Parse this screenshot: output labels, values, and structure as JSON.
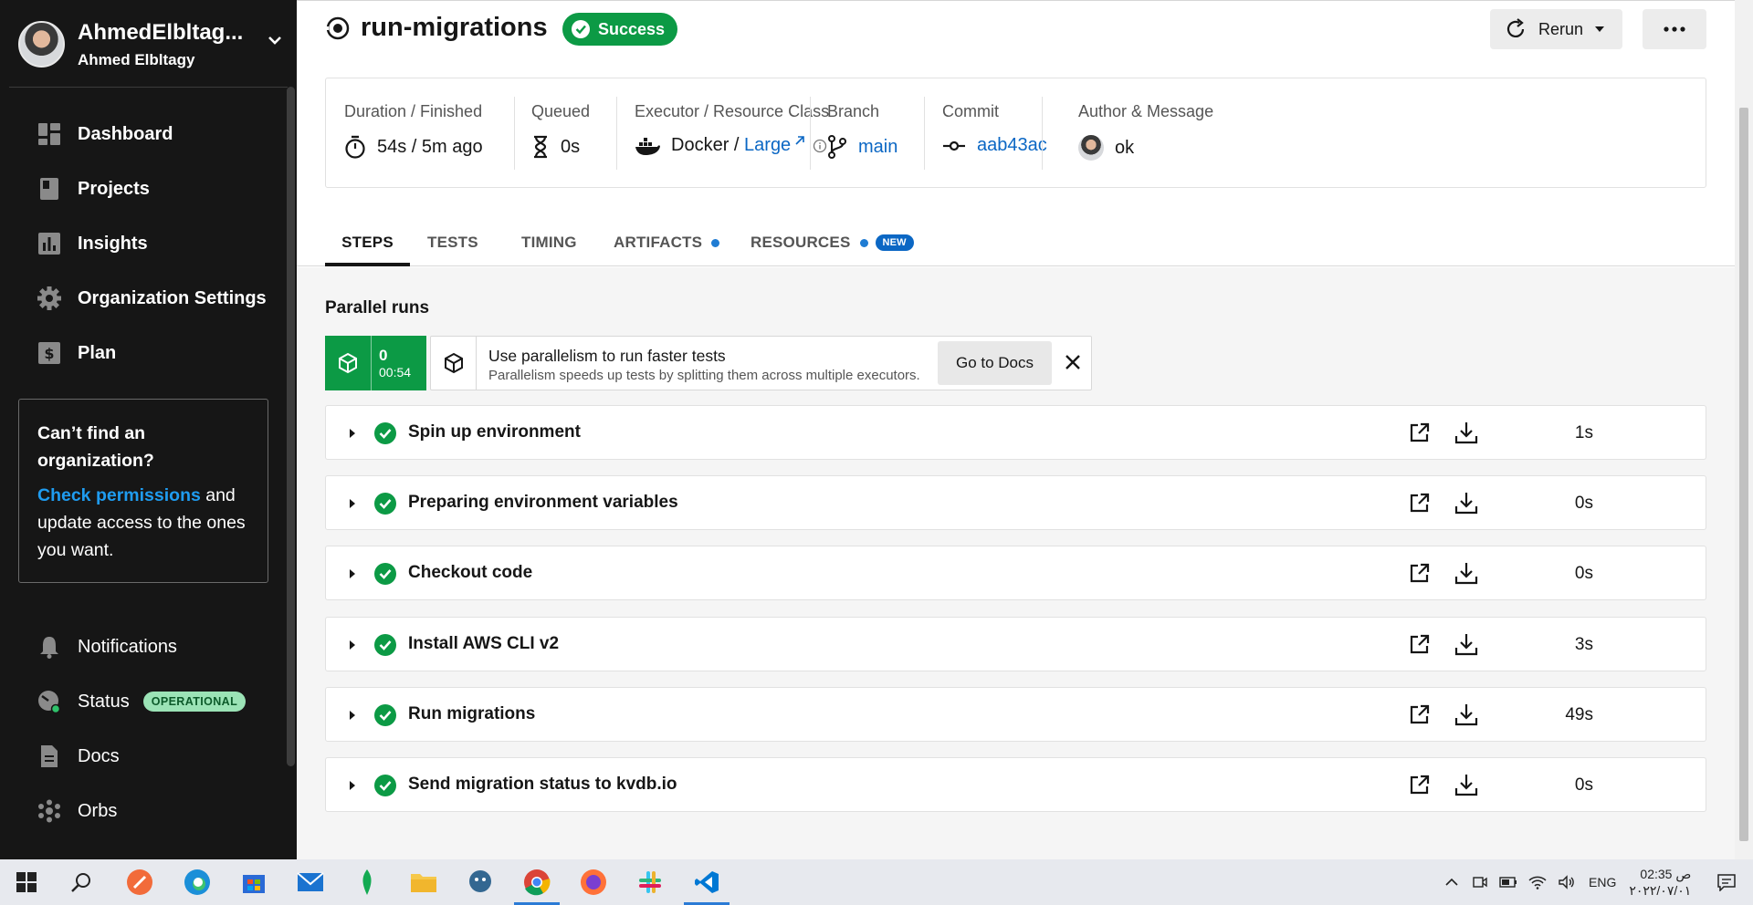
{
  "sidebar": {
    "org_name": "AhmedElbltag...",
    "org_user": "Ahmed Elbltagy",
    "nav": [
      {
        "label": "Dashboard",
        "icon": "dashboard-icon"
      },
      {
        "label": "Projects",
        "icon": "projects-icon"
      },
      {
        "label": "Insights",
        "icon": "insights-icon"
      },
      {
        "label": "Organization Settings",
        "icon": "gear-icon"
      },
      {
        "label": "Plan",
        "icon": "dollar-icon"
      }
    ],
    "org_box": {
      "question": "Can’t find an organization?",
      "link": "Check permissions",
      "rest": " and update access to the ones you want."
    },
    "bottom": [
      {
        "label": "Notifications",
        "icon": "bell-icon"
      },
      {
        "label": "Status",
        "icon": "status-icon",
        "badge": "OPERATIONAL"
      },
      {
        "label": "Docs",
        "icon": "docs-icon"
      },
      {
        "label": "Orbs",
        "icon": "orbs-icon"
      }
    ]
  },
  "header": {
    "job_title": "run-migrations",
    "status": "Success",
    "rerun_label": "Rerun"
  },
  "meta": {
    "duration": {
      "label": "Duration / Finished",
      "value": "54s / 5m ago"
    },
    "queued": {
      "label": "Queued",
      "value": "0s"
    },
    "executor": {
      "label": "Executor / Resource Class",
      "value": "Docker / ",
      "link": "Large"
    },
    "branch": {
      "label": "Branch",
      "value": "main"
    },
    "commit": {
      "label": "Commit",
      "value": "aab43ac"
    },
    "author": {
      "label": "Author & Message",
      "value": "ok"
    }
  },
  "tabs": [
    {
      "label": "STEPS",
      "active": true
    },
    {
      "label": "TESTS"
    },
    {
      "label": "TIMING"
    },
    {
      "label": "ARTIFACTS",
      "dot": true
    },
    {
      "label": "RESOURCES",
      "dot": true,
      "badge": "NEW"
    }
  ],
  "parallel": {
    "title": "Parallel runs",
    "run_index": "0",
    "run_time": "00:54",
    "banner_title": "Use parallelism to run faster tests",
    "banner_text": "Parallelism speeds up tests by splitting them across multiple executors.",
    "docs_button": "Go to Docs"
  },
  "steps": [
    {
      "name": "Spin up environment",
      "duration": "1s"
    },
    {
      "name": "Preparing environment variables",
      "duration": "0s"
    },
    {
      "name": "Checkout code",
      "duration": "0s"
    },
    {
      "name": "Install AWS CLI v2",
      "duration": "3s"
    },
    {
      "name": "Run migrations",
      "duration": "49s"
    },
    {
      "name": "Send migration status to kvdb.io",
      "duration": "0s"
    }
  ],
  "taskbar": {
    "lang": "ENG",
    "time": "02:35 ص",
    "date": "٢٠٢٢/٠٧/٠١"
  },
  "colors": {
    "success": "#0c9a45",
    "link": "#0b67c4",
    "sidebar_bg": "#161616"
  }
}
